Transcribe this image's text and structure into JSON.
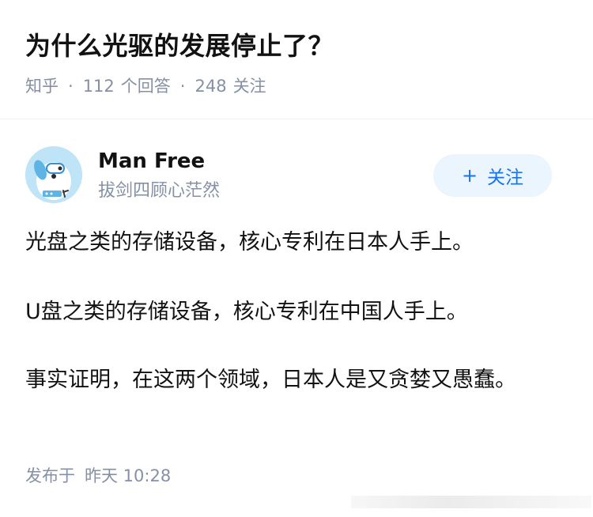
{
  "question": {
    "title": "为什么光驱的发展停止了？",
    "source": "知乎",
    "separator": "·",
    "answers_count": "112",
    "answers_label": "个回答",
    "followers_count": "248",
    "followers_label": "关注"
  },
  "answer": {
    "author": {
      "name": "Man Free",
      "bio": "拔剑四顾心茫然",
      "avatar_icon": "cartoon-dog-avatar"
    },
    "follow_button": {
      "icon": "plus-icon",
      "plus": "+",
      "label": "关注"
    },
    "paragraphs": [
      "光盘之类的存储设备，核心专利在日本人手上。",
      "U盘之类的存储设备，核心专利在中国人手上。",
      "事实证明，在这两个领域，日本人是又贪婪又愚蠢。"
    ],
    "publish": {
      "label": "发布于",
      "time": "昨天 10:28"
    }
  },
  "colors": {
    "accent": "#1772f6",
    "meta_gray": "#8590a6",
    "follow_bg": "#ebf5fd",
    "avatar_bg": "#bfe3f7"
  }
}
